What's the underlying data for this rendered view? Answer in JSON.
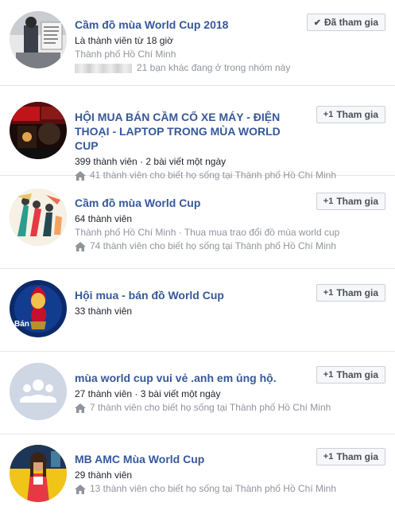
{
  "groups": [
    {
      "title": "Cầm đồ mùa World Cup 2018",
      "line1": "Là thành viên từ 18 giờ",
      "line2": "Thành phố Hồ Chí Minh",
      "line3": "21 bạn khác đang ở trong nhóm này",
      "button_icon": "✔",
      "button_label": "Đã tham gia"
    },
    {
      "title": "HỘI MUA BÁN CẦM CỐ XE MÁY - ĐIỆN THOẠI - LAPTOP TRONG MÙA WORLD CUP",
      "line1": "399 thành viên · 2 bài viết một ngày",
      "line3": "41 thành viên cho biết họ sống tại Thành phố Hồ Chí Minh",
      "button_icon": "+1",
      "button_label": "Tham gia"
    },
    {
      "title": "Cầm đồ mùa World Cup",
      "line1": "64 thành viên",
      "line2": "Thành phố Hồ Chí Minh · Thua mua trao đổi đồ mùa world cup",
      "line3": "74 thành viên cho biết họ sống tại Thành phố Hồ Chí Minh",
      "button_icon": "+1",
      "button_label": "Tham gia"
    },
    {
      "title": "Hội mua - bán đồ World Cup",
      "line1": "33 thành viên",
      "avatar_text": "Bán",
      "button_icon": "+1",
      "button_label": "Tham gia"
    },
    {
      "title": "mùa world cup vui vẻ .anh em ủng hộ.",
      "line1": "27 thành viên · 3 bài viết một ngày",
      "line3": "7 thành viên cho biết họ sống tại Thành phố Hồ Chí Minh",
      "button_icon": "+1",
      "button_label": "Tham gia"
    },
    {
      "title": "MB AMC Mùa World Cup",
      "line1": "29 thành viên",
      "line3": "13 thành viên cho biết họ sống tại Thành phố Hồ Chí Minh",
      "button_icon": "+1",
      "button_label": "Tham gia"
    }
  ],
  "colors": {
    "link": "#365899",
    "secondary_text": "#90949c",
    "button_bg": "#f6f7f9",
    "button_border": "#ccd0d5"
  }
}
